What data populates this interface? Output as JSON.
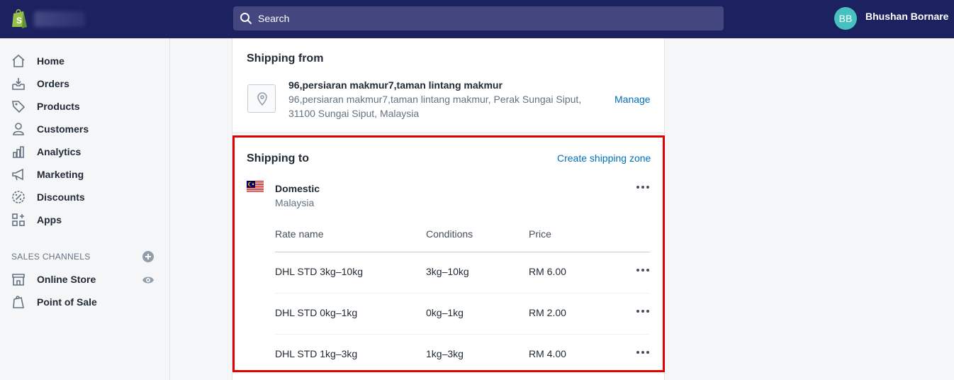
{
  "header": {
    "search_placeholder": "Search",
    "user_initials": "BB",
    "user_name": "Bhushan Bornare"
  },
  "sidebar": {
    "items": [
      {
        "label": "Home",
        "icon": "home-icon"
      },
      {
        "label": "Orders",
        "icon": "orders-icon"
      },
      {
        "label": "Products",
        "icon": "tag-icon"
      },
      {
        "label": "Customers",
        "icon": "person-icon"
      },
      {
        "label": "Analytics",
        "icon": "bar-chart-icon"
      },
      {
        "label": "Marketing",
        "icon": "megaphone-icon"
      },
      {
        "label": "Discounts",
        "icon": "discount-icon"
      },
      {
        "label": "Apps",
        "icon": "apps-icon"
      }
    ],
    "sales_channels_title": "SALES CHANNELS",
    "channels": [
      {
        "label": "Online Store",
        "icon": "store-icon"
      },
      {
        "label": "Point of Sale",
        "icon": "shopping-bag-icon"
      }
    ]
  },
  "shipping_from": {
    "title": "Shipping from",
    "location_name": "96,persiaran makmur7,taman lintang makmur",
    "address_line1": "96,persiaran makmur7,taman lintang makmur, Perak Sungai Siput,",
    "address_line2": "31100 Sungai Siput, Malaysia",
    "manage_label": "Manage"
  },
  "shipping_to": {
    "title": "Shipping to",
    "create_zone_label": "Create shipping zone",
    "zone": {
      "name": "Domestic",
      "country": "Malaysia",
      "flag": "malaysia-flag"
    },
    "columns": {
      "rate_name": "Rate name",
      "conditions": "Conditions",
      "price": "Price"
    },
    "rates": [
      {
        "name": "DHL STD 3kg–10kg",
        "conditions": "3kg–10kg",
        "price": "RM 6.00"
      },
      {
        "name": "DHL STD 0kg–1kg",
        "conditions": "0kg–1kg",
        "price": "RM 2.00"
      },
      {
        "name": "DHL STD 1kg–3kg",
        "conditions": "1kg–3kg",
        "price": "RM 4.00"
      }
    ]
  },
  "colors": {
    "topbar": "#1c2260",
    "search": "#43467f",
    "avatar": "#47c1bf",
    "link": "#006fbb",
    "highlight": "#e00000"
  }
}
